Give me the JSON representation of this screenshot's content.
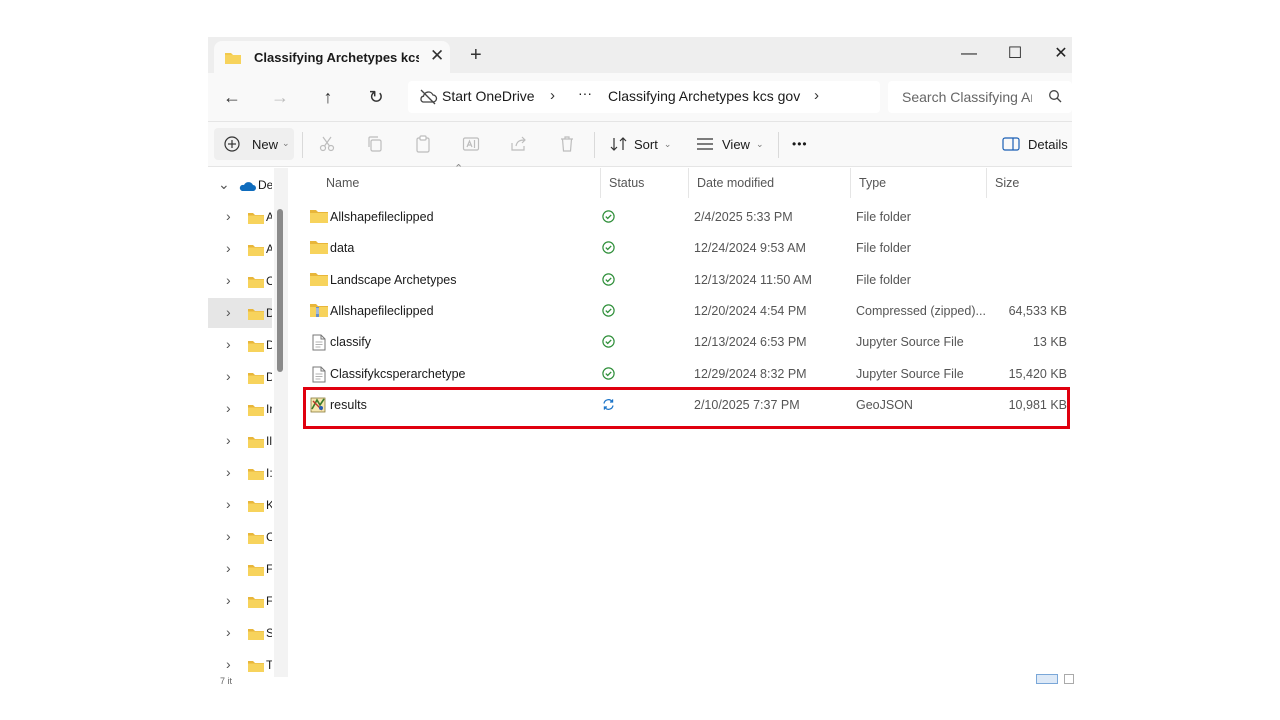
{
  "window": {
    "tab_title": "Classifying Archetypes kcs gov",
    "tab_close_icon": "close-icon",
    "new_tab_label": "+",
    "controls": {
      "minimize": "—",
      "maximize": "☐",
      "close": "✕"
    }
  },
  "nav": {
    "back": "←",
    "forward": "→",
    "up": "↑",
    "refresh": "↻"
  },
  "address": {
    "crumbs": [
      "Start OneDrive",
      "···",
      "Classifying Archetypes kcs gov"
    ],
    "separators": [
      "›",
      "›"
    ],
    "search_placeholder": "Search Classifying Ar"
  },
  "toolbar": {
    "new_label": "New",
    "sort_label": "Sort",
    "view_label": "View",
    "more_label": "•••",
    "details_label": "Details"
  },
  "sidebar": {
    "root_label": "De",
    "items": [
      {
        "label": "A"
      },
      {
        "label": "A"
      },
      {
        "label": "C"
      },
      {
        "label": "D"
      },
      {
        "label": "D"
      },
      {
        "label": "D"
      },
      {
        "label": "Ir"
      },
      {
        "label": "Il"
      },
      {
        "label": "I:"
      },
      {
        "label": "K"
      },
      {
        "label": "C"
      },
      {
        "label": "F"
      },
      {
        "label": "F"
      },
      {
        "label": "S"
      },
      {
        "label": "T"
      }
    ],
    "selected_index": 3
  },
  "columns": {
    "name": "Name",
    "status": "Status",
    "date": "Date modified",
    "type": "Type",
    "size": "Size"
  },
  "files": [
    {
      "name": "Allshapefileclipped",
      "date": "2/4/2025 5:33 PM",
      "type": "File folder",
      "size": "",
      "icon": "folder-icon",
      "status": "synced-icon"
    },
    {
      "name": "data",
      "date": "12/24/2024 9:53 AM",
      "type": "File folder",
      "size": "",
      "icon": "folder-icon",
      "status": "synced-icon"
    },
    {
      "name": "Landscape Archetypes",
      "date": "12/13/2024 11:50 AM",
      "type": "File folder",
      "size": "",
      "icon": "folder-icon",
      "status": "synced-icon"
    },
    {
      "name": "Allshapefileclipped",
      "date": "12/20/2024 4:54 PM",
      "type": "Compressed (zipped)...",
      "size": "64,533 KB",
      "icon": "zip-folder-icon",
      "status": "synced-icon"
    },
    {
      "name": "classify",
      "date": "12/13/2024 6:53 PM",
      "type": "Jupyter Source File",
      "size": "13 KB",
      "icon": "document-icon",
      "status": "synced-icon"
    },
    {
      "name": "Classifykcsperarchetype",
      "date": "12/29/2024 8:32 PM",
      "type": "Jupyter Source File",
      "size": "15,420 KB",
      "icon": "document-icon",
      "status": "synced-icon"
    },
    {
      "name": "results",
      "date": "2/10/2025 7:37 PM",
      "type": "GeoJSON",
      "size": "10,981 KB",
      "icon": "geojson-icon",
      "status": "syncing-icon"
    }
  ],
  "footer": {
    "count_label": "7 it"
  },
  "colors": {
    "highlight": "#e0000f",
    "synced": "#2f8f3a",
    "syncing": "#1a73c8",
    "folder": "#f2c94c"
  }
}
